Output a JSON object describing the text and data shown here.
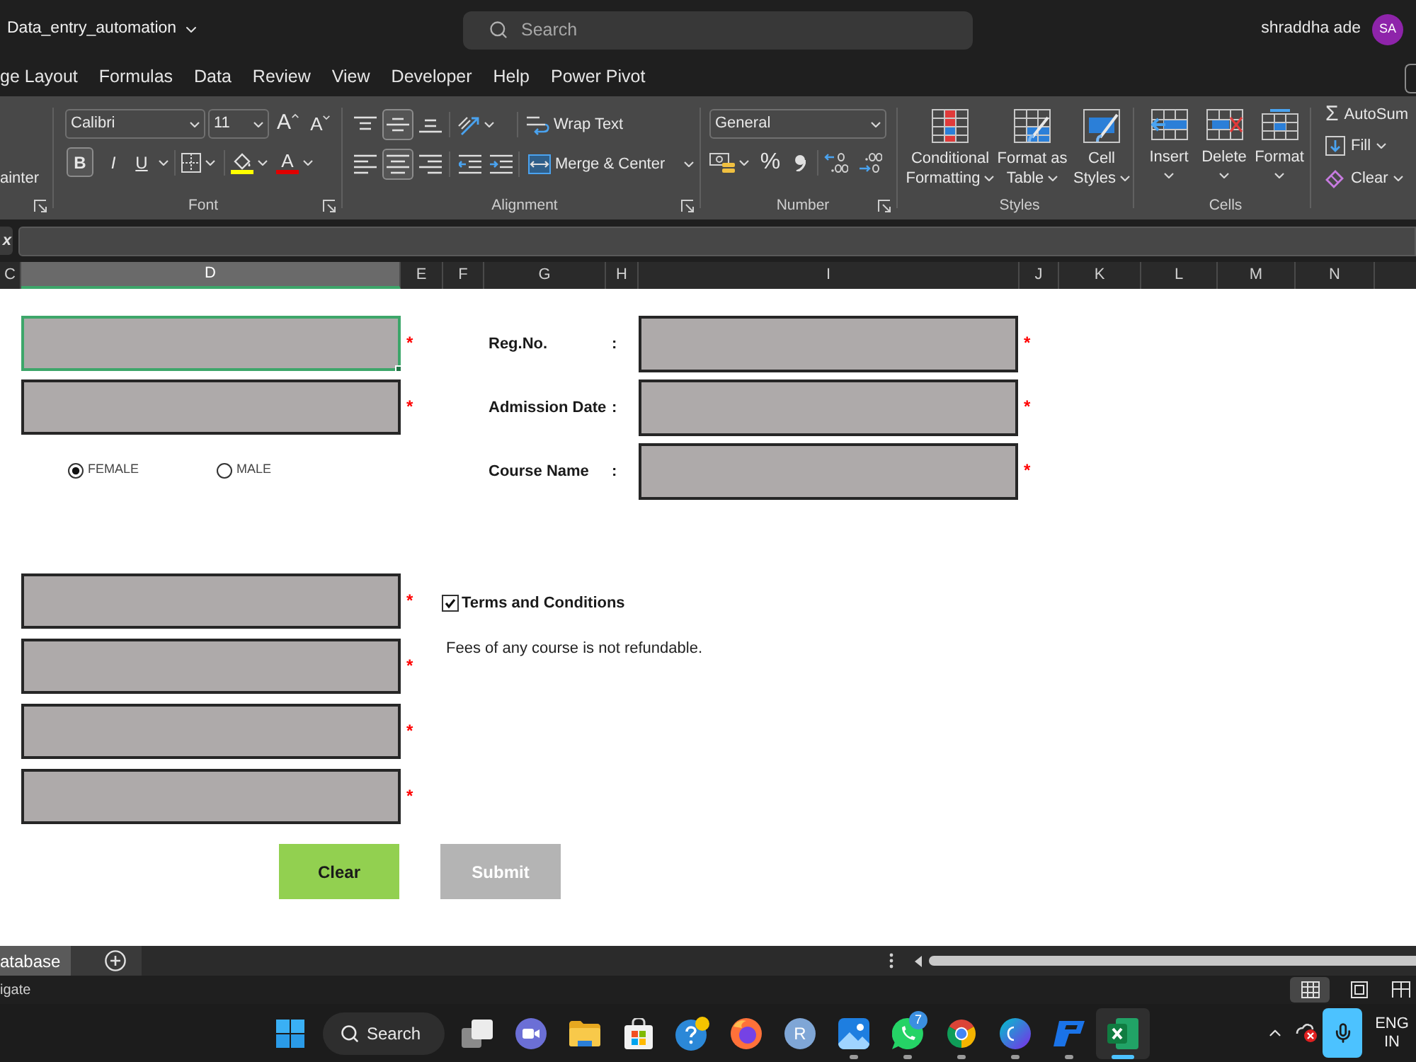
{
  "window": {
    "title": "Data_entry_automation",
    "search": {
      "placeholder": "Search"
    },
    "user": {
      "name": "shraddha ade",
      "initials": "SA"
    }
  },
  "ribbon_tabs": [
    {
      "label": "ge Layout",
      "selected": false
    },
    {
      "label": "Formulas",
      "selected": false
    },
    {
      "label": "Data",
      "selected": false
    },
    {
      "label": "Review",
      "selected": false
    },
    {
      "label": "View",
      "selected": false
    },
    {
      "label": "Developer",
      "selected": false
    },
    {
      "label": "Help",
      "selected": false
    },
    {
      "label": "Power Pivot",
      "selected": false
    }
  ],
  "ribbon": {
    "clipboard": {
      "partial_label": "ainter"
    },
    "font": {
      "font_name": "Calibri",
      "font_size": "11",
      "grow": "A",
      "shrink": "A",
      "bold": {
        "label": "B",
        "on": true
      },
      "italic": {
        "label": "I",
        "on": false
      },
      "underline": {
        "label": "U",
        "on": false
      },
      "font_color": "A",
      "label": "Font"
    },
    "alignment": {
      "vertical": [
        {
          "kind": "top",
          "selected": false
        },
        {
          "kind": "middle",
          "selected": true
        },
        {
          "kind": "bottom",
          "selected": false
        }
      ],
      "horizontal": [
        {
          "kind": "left",
          "selected": false
        },
        {
          "kind": "center",
          "selected": true
        },
        {
          "kind": "right",
          "selected": false
        }
      ],
      "wrap_text": "Wrap Text",
      "merge": "Merge & Center",
      "label": "Alignment"
    },
    "number": {
      "format": "General",
      "percent": "%",
      "label": "Number"
    },
    "styles": {
      "buttons": [
        {
          "kind": "conditional",
          "lines": [
            "Conditional",
            "Formatting"
          ]
        },
        {
          "kind": "table",
          "lines": [
            "Format as",
            "Table"
          ]
        },
        {
          "kind": "cell",
          "lines": [
            "Cell",
            "Styles"
          ]
        }
      ],
      "label": "Styles"
    },
    "cells": {
      "buttons": [
        {
          "kind": "insert",
          "label": "Insert"
        },
        {
          "kind": "delete",
          "label": "Delete"
        },
        {
          "kind": "format",
          "label": "Format"
        }
      ],
      "label": "Cells"
    },
    "editing": {
      "autosum": {
        "symbol": "Σ",
        "label": "AutoSum"
      },
      "fill": "Fill",
      "clear": "Clear"
    }
  },
  "formula_bar": {
    "function_button": "x"
  },
  "column_headers": [
    {
      "label": "C",
      "selected": false
    },
    {
      "label": "D",
      "selected": true
    },
    {
      "label": "E",
      "selected": false
    },
    {
      "label": "F",
      "selected": false
    },
    {
      "label": "G",
      "selected": false
    },
    {
      "label": "H",
      "selected": false
    },
    {
      "label": "I",
      "selected": false
    },
    {
      "label": "J",
      "selected": false
    },
    {
      "label": "K",
      "selected": false
    },
    {
      "label": "L",
      "selected": false
    },
    {
      "label": "M",
      "selected": false
    },
    {
      "label": "N",
      "selected": false
    }
  ],
  "form": {
    "left_fields": [
      {
        "marker": "*",
        "active": true
      },
      {
        "marker": "*",
        "active": false
      }
    ],
    "gender": [
      {
        "label": "FEMALE",
        "selected": true
      },
      {
        "label": "MALE",
        "selected": false
      }
    ],
    "right_fields": [
      {
        "label": "Reg.No.",
        "colon": ":",
        "marker": "*"
      },
      {
        "label": "Admission Date",
        "colon": ":",
        "marker": "*"
      },
      {
        "label": "Course Name",
        "colon": ":",
        "marker": "*"
      }
    ],
    "lower_fields": [
      {
        "marker": "*"
      },
      {
        "marker": "*"
      },
      {
        "marker": "*"
      },
      {
        "marker": "*"
      }
    ],
    "terms": {
      "label": "Terms and Conditions",
      "checked": true
    },
    "note": "Fees of any course is not refundable.",
    "buttons": [
      {
        "label": "Clear",
        "disabled": false
      },
      {
        "label": "Submit",
        "disabled": true
      }
    ]
  },
  "sheet_tabs": [
    {
      "label": "atabase",
      "selected": true
    }
  ],
  "status_bar": {
    "text": "igate",
    "views": [
      {
        "kind": "normal",
        "selected": true
      },
      {
        "kind": "page_layout",
        "selected": false
      },
      {
        "kind": "page_break",
        "selected": false
      }
    ]
  },
  "taskbar": {
    "search": "Search",
    "apps": [
      {
        "kind": "task_view",
        "running": false,
        "active": false
      },
      {
        "kind": "video_call",
        "running": false,
        "active": false
      },
      {
        "kind": "folder",
        "running": false,
        "active": false
      },
      {
        "kind": "store",
        "running": false,
        "active": false
      },
      {
        "kind": "help",
        "running": false,
        "active": false
      },
      {
        "kind": "fox_browser",
        "running": false,
        "active": false
      },
      {
        "kind": "letter_app",
        "label": "R",
        "running": false,
        "active": false
      },
      {
        "kind": "photos",
        "running": true,
        "active": false
      },
      {
        "kind": "chat",
        "badge": "7",
        "running": true,
        "active": false
      },
      {
        "kind": "chrome_browser",
        "running": true,
        "active": false
      },
      {
        "kind": "design_app",
        "running": true,
        "active": false
      },
      {
        "kind": "blue_app",
        "running": true,
        "active": false
      },
      {
        "kind": "spreadsheet",
        "running": true,
        "active": true
      }
    ],
    "tray": {
      "language": "ENG",
      "region": "IN"
    }
  }
}
